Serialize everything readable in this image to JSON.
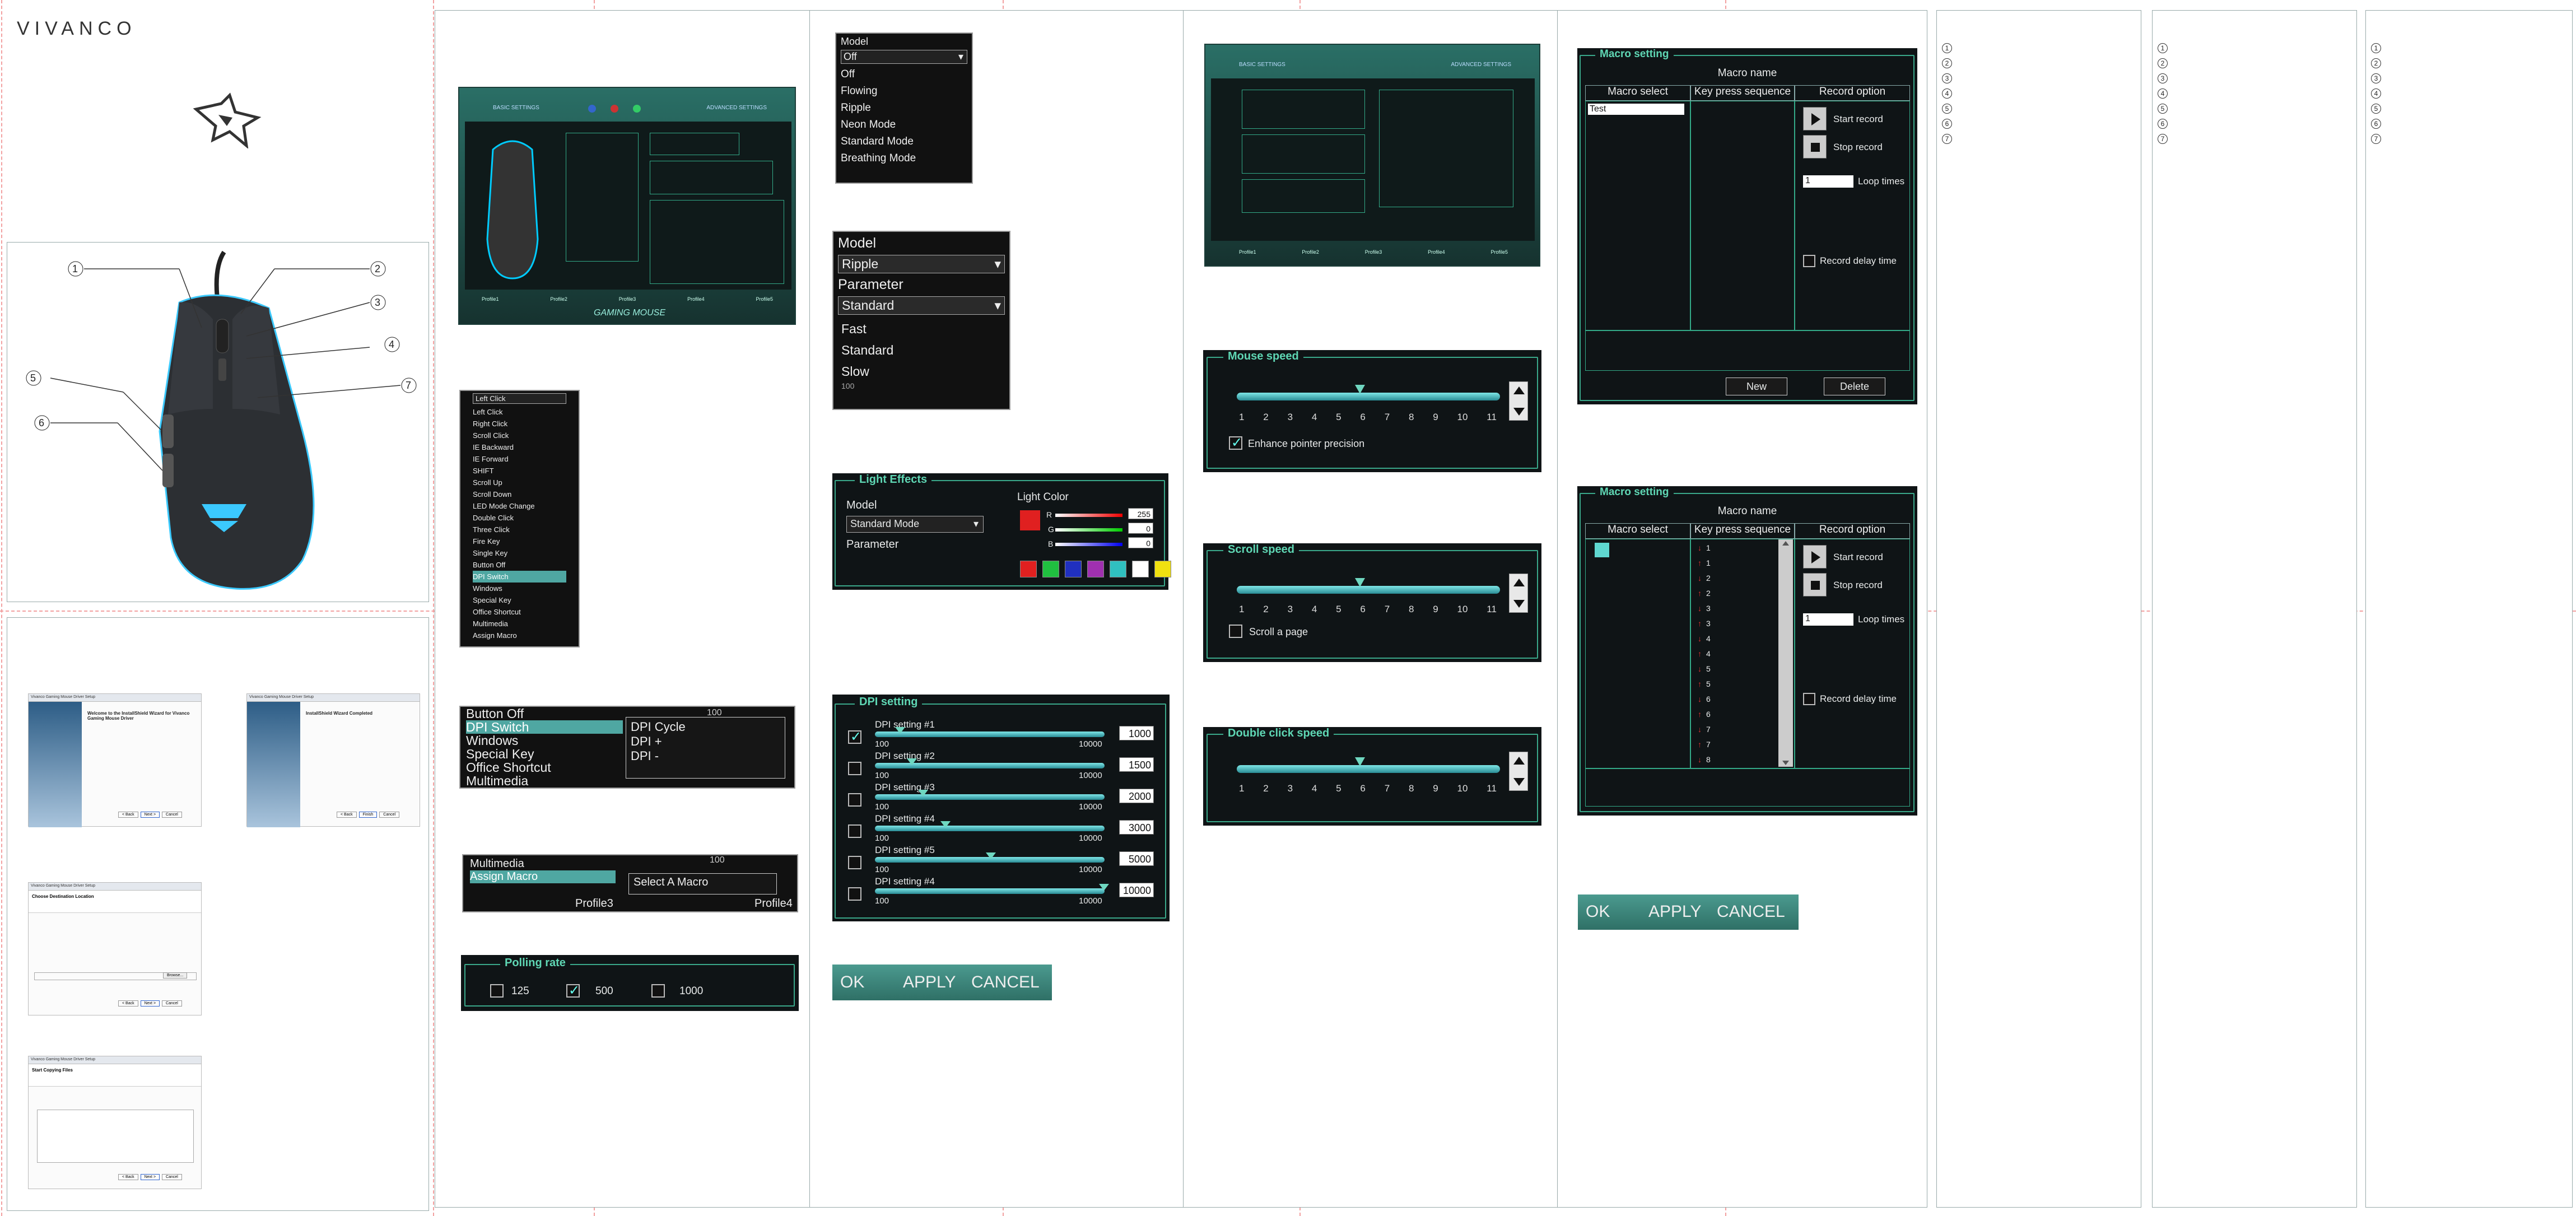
{
  "brand": "VIVANCO",
  "mouse_callouts": [
    "1",
    "2",
    "3",
    "4",
    "5",
    "6",
    "7"
  ],
  "number_lists": [
    [
      "1",
      "2",
      "3",
      "4",
      "5",
      "6",
      "7"
    ],
    [
      "1",
      "2",
      "3",
      "4",
      "5",
      "6",
      "7"
    ],
    [
      "1",
      "2",
      "3",
      "4",
      "5",
      "6",
      "7"
    ]
  ],
  "model_dropdown": {
    "label": "Model",
    "value": "Off",
    "options": [
      "Off",
      "Flowing",
      "Ripple",
      "Neon Mode",
      "Standard Mode",
      "Breathing Mode"
    ]
  },
  "ripple_panel": {
    "model_label": "Model",
    "model_value": "Ripple",
    "parameter_label": "Parameter",
    "parameter_value": "Standard",
    "options": [
      "Fast",
      "Standard",
      "Slow"
    ],
    "partial_value": "100"
  },
  "light_effects": {
    "title": "Light Effects",
    "model_label": "Model",
    "model_value": "Standard Mode",
    "parameter_label": "Parameter",
    "light_color_label": "Light Color",
    "r_label": "R",
    "g_label": "G",
    "b_label": "B",
    "r_value": "255",
    "g_value": "0",
    "b_value": "0",
    "swatches": [
      "#e02020",
      "#20c040",
      "#2030c0",
      "#a030b0",
      "#30c0c0",
      "#ffffff",
      "#f0e010"
    ]
  },
  "key_menu": {
    "header": "Left Click",
    "items": [
      "Left Click",
      "Right Click",
      "Scroll Click",
      "IE Backward",
      "IE Forward",
      "SHIFT",
      "Scroll Up",
      "Scroll Down",
      "LED Mode Change",
      "Double Click",
      "Three Click",
      "Fire Key",
      "Single Key",
      "Button Off",
      "DPI Switch",
      "Windows",
      "Special Key",
      "Office Shortcut",
      "Multimedia",
      "Assign Macro"
    ],
    "submenu_items": [
      "DPI Switch",
      "Windows",
      "Special Key",
      "Office Shortcut",
      "Multimedia",
      "Assign Macro"
    ]
  },
  "dpi_menu": {
    "items": [
      "Button Off",
      "DPI Switch",
      "Windows",
      "Special Key",
      "Office Shortcut",
      "Multimedia"
    ],
    "submenu": [
      "DPI Cycle",
      "DPI +",
      "DPI -"
    ],
    "bg_value": "100"
  },
  "macro_menu": {
    "items": [
      "Multimedia",
      "Assign Macro"
    ],
    "submenu": [
      "Select A Macro"
    ],
    "profile_left": "Profile3",
    "profile_right": "Profile4",
    "bg_value": "100"
  },
  "polling_rate": {
    "title": "Polling rate",
    "options": [
      "125",
      "500",
      "1000"
    ],
    "checked": "500"
  },
  "dpi_setting": {
    "title": "DPI setting",
    "min_label": "100",
    "max_label": "10000",
    "rows": [
      {
        "label": "DPI setting #1",
        "value": "1000",
        "checked": true
      },
      {
        "label": "DPI setting #2",
        "value": "1500",
        "checked": false
      },
      {
        "label": "DPI setting #3",
        "value": "2000",
        "checked": false
      },
      {
        "label": "DPI setting #4",
        "value": "3000",
        "checked": false
      },
      {
        "label": "DPI setting #5",
        "value": "5000",
        "checked": false
      },
      {
        "label": "DPI setting #4",
        "value": "10000",
        "checked": false
      }
    ]
  },
  "buttons_bar": {
    "ok": "OK",
    "apply": "APPLY",
    "cancel": "CANCEL"
  },
  "mouse_speed": {
    "title": "Mouse speed",
    "ticks": [
      "1",
      "2",
      "3",
      "4",
      "5",
      "6",
      "7",
      "8",
      "9",
      "10",
      "11"
    ],
    "checkbox": "Enhance pointer precision",
    "level": 6
  },
  "scroll_speed": {
    "title": "Scroll speed",
    "ticks": [
      "1",
      "2",
      "3",
      "4",
      "5",
      "6",
      "7",
      "8",
      "9",
      "10",
      "11"
    ],
    "checkbox": "Scroll a page",
    "level": 6
  },
  "double_click_speed": {
    "title": "Double click speed",
    "ticks": [
      "1",
      "2",
      "3",
      "4",
      "5",
      "6",
      "7",
      "8",
      "9",
      "10",
      "11"
    ],
    "level": 6
  },
  "macro_setting": {
    "title": "Macro setting",
    "macro_name_label": "Macro name",
    "col_select": "Macro select",
    "col_sequence": "Key press sequence",
    "col_option": "Record option",
    "start_record": "Start record",
    "stop_record": "Stop record",
    "loop_value": "1",
    "loop_label": "Loop times",
    "record_delay": "Record delay time",
    "new_button": "New",
    "delete_button": "Delete",
    "macro_entry": "Test",
    "sequence": [
      "1",
      "1",
      "2",
      "2",
      "3",
      "3",
      "4",
      "4",
      "5",
      "5",
      "6",
      "6",
      "7",
      "7",
      "8"
    ]
  },
  "gaming_screen": {
    "basic_tab": "BASIC SETTINGS",
    "advanced_tab": "ADVANCED SETTINGS",
    "footer": "GAMING MOUSE",
    "profiles": [
      "Profile1",
      "Profile2",
      "Profile3",
      "Profile4",
      "Profile5"
    ]
  },
  "installer": {
    "title1": "Vivanco Gaming Mouse Driver Setup",
    "welcome": "Welcome to the InstallShield Wizard for Vivanco Gaming Mouse Driver",
    "complete": "InstallShield Wizard Completed",
    "destination": "Choose Destination Location",
    "start_copy": "Start Copying Files",
    "back": "< Back",
    "next": "Next >",
    "cancel": "Cancel",
    "finish": "Finish",
    "browse": "Browse..."
  }
}
